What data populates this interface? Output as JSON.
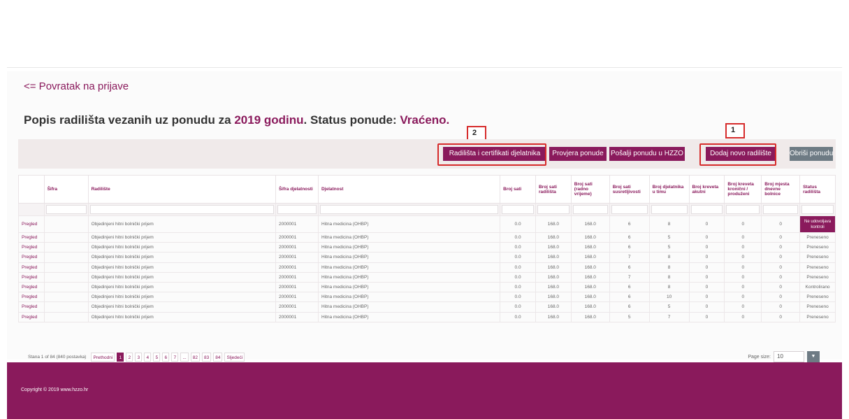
{
  "nav": {
    "back_link": "<= Povratak na prijave"
  },
  "heading": {
    "prefix": "Popis radilišta vezanih uz ponudu za ",
    "year": "2019 godinu",
    "middle": ". Status ponude: ",
    "status": "Vraćeno."
  },
  "callouts": {
    "one": "1",
    "two": "2"
  },
  "toolbar": {
    "certificates_button": "Radilišta i certifikati djelatnika",
    "review_button": "Provjera ponude",
    "send_button": "Pošalji ponudu u HZZO",
    "add_button": "Dodaj novo radilište",
    "delete_button": "Obriši ponudu"
  },
  "table": {
    "headers": [
      "",
      "Šifra",
      "Radilište",
      "Šifra djelatnosti",
      "Djelatnost",
      "Broj sati",
      "Broj sati radilišta",
      "Broj sati (radno vrijeme)",
      "Broj sati susretljivosti",
      "Broj djelatnika u timu",
      "Broj kreveta akutni",
      "Broj kreveta kronični / produženi",
      "Broj mjesta dnevne bolnice",
      "Status radilišta"
    ],
    "rows": [
      [
        "Pregled",
        "",
        "Objedinjeni hitni bolnički prijem",
        "2000001",
        "Hitna medicina (OHBP)",
        "0.0",
        "168.0",
        "168.0",
        "6",
        "8",
        "0",
        "0",
        "0",
        "Ne udovoljava kontroli"
      ],
      [
        "Pregled",
        "",
        "Objedinjeni hitni bolnički prijem",
        "2000001",
        "Hitna medicina (OHBP)",
        "0.0",
        "168.0",
        "168.0",
        "6",
        "5",
        "0",
        "0",
        "0",
        "Preneseno"
      ],
      [
        "Pregled",
        "",
        "Objedinjeni hitni bolnički prijem",
        "2000001",
        "Hitna medicina (OHBP)",
        "0.0",
        "168.0",
        "168.0",
        "6",
        "5",
        "0",
        "0",
        "0",
        "Preneseno"
      ],
      [
        "Pregled",
        "",
        "Objedinjeni hitni bolnički prijem",
        "2000001",
        "Hitna medicina (OHBP)",
        "0.0",
        "168.0",
        "168.0",
        "7",
        "8",
        "0",
        "0",
        "0",
        "Preneseno"
      ],
      [
        "Pregled",
        "",
        "Objedinjeni hitni bolnički prijem",
        "2000001",
        "Hitna medicina (OHBP)",
        "0.0",
        "168.0",
        "168.0",
        "6",
        "8",
        "0",
        "0",
        "0",
        "Preneseno"
      ],
      [
        "Pregled",
        "",
        "Objedinjeni hitni bolnički prijem",
        "2000001",
        "Hitna medicina (OHBP)",
        "0.0",
        "168.0",
        "168.0",
        "7",
        "8",
        "0",
        "0",
        "0",
        "Preneseno"
      ],
      [
        "Pregled",
        "",
        "Objedinjeni hitni bolnički prijem",
        "2000001",
        "Hitna medicina (OHBP)",
        "0.0",
        "168.0",
        "168.0",
        "6",
        "8",
        "0",
        "0",
        "0",
        "Kontrolirano"
      ],
      [
        "Pregled",
        "",
        "Objedinjeni hitni bolnički prijem",
        "2000001",
        "Hitna medicina (OHBP)",
        "0.0",
        "168.0",
        "168.0",
        "6",
        "10",
        "0",
        "0",
        "0",
        "Preneseno"
      ],
      [
        "Pregled",
        "",
        "Objedinjeni hitni bolnički prijem",
        "2000001",
        "Hitna medicina (OHBP)",
        "0.0",
        "168.0",
        "168.0",
        "6",
        "5",
        "0",
        "0",
        "0",
        "Preneseno"
      ],
      [
        "Pregled",
        "",
        "Objedinjeni hitni bolnički prijem",
        "2000001",
        "Hitna medicina (OHBP)",
        "0.0",
        "168.0",
        "168.0",
        "5",
        "7",
        "0",
        "0",
        "0",
        "Preneseno"
      ]
    ]
  },
  "pager": {
    "info": "Stana 1 of 84 (840 postavka)",
    "prev": "Prethodni",
    "pages": [
      "1",
      "2",
      "3",
      "4",
      "5",
      "6",
      "7",
      "...",
      "82",
      "83",
      "84"
    ],
    "next": "Sljedeći"
  },
  "page_size": {
    "label": "Page size:",
    "value": "10"
  },
  "footer": {
    "copyright": "Copyright © 2019 www.hzzo.hr"
  },
  "colors": {
    "accent": "#8a1a5c",
    "gray_button": "#6e7b84",
    "callout": "#d62b2b"
  }
}
